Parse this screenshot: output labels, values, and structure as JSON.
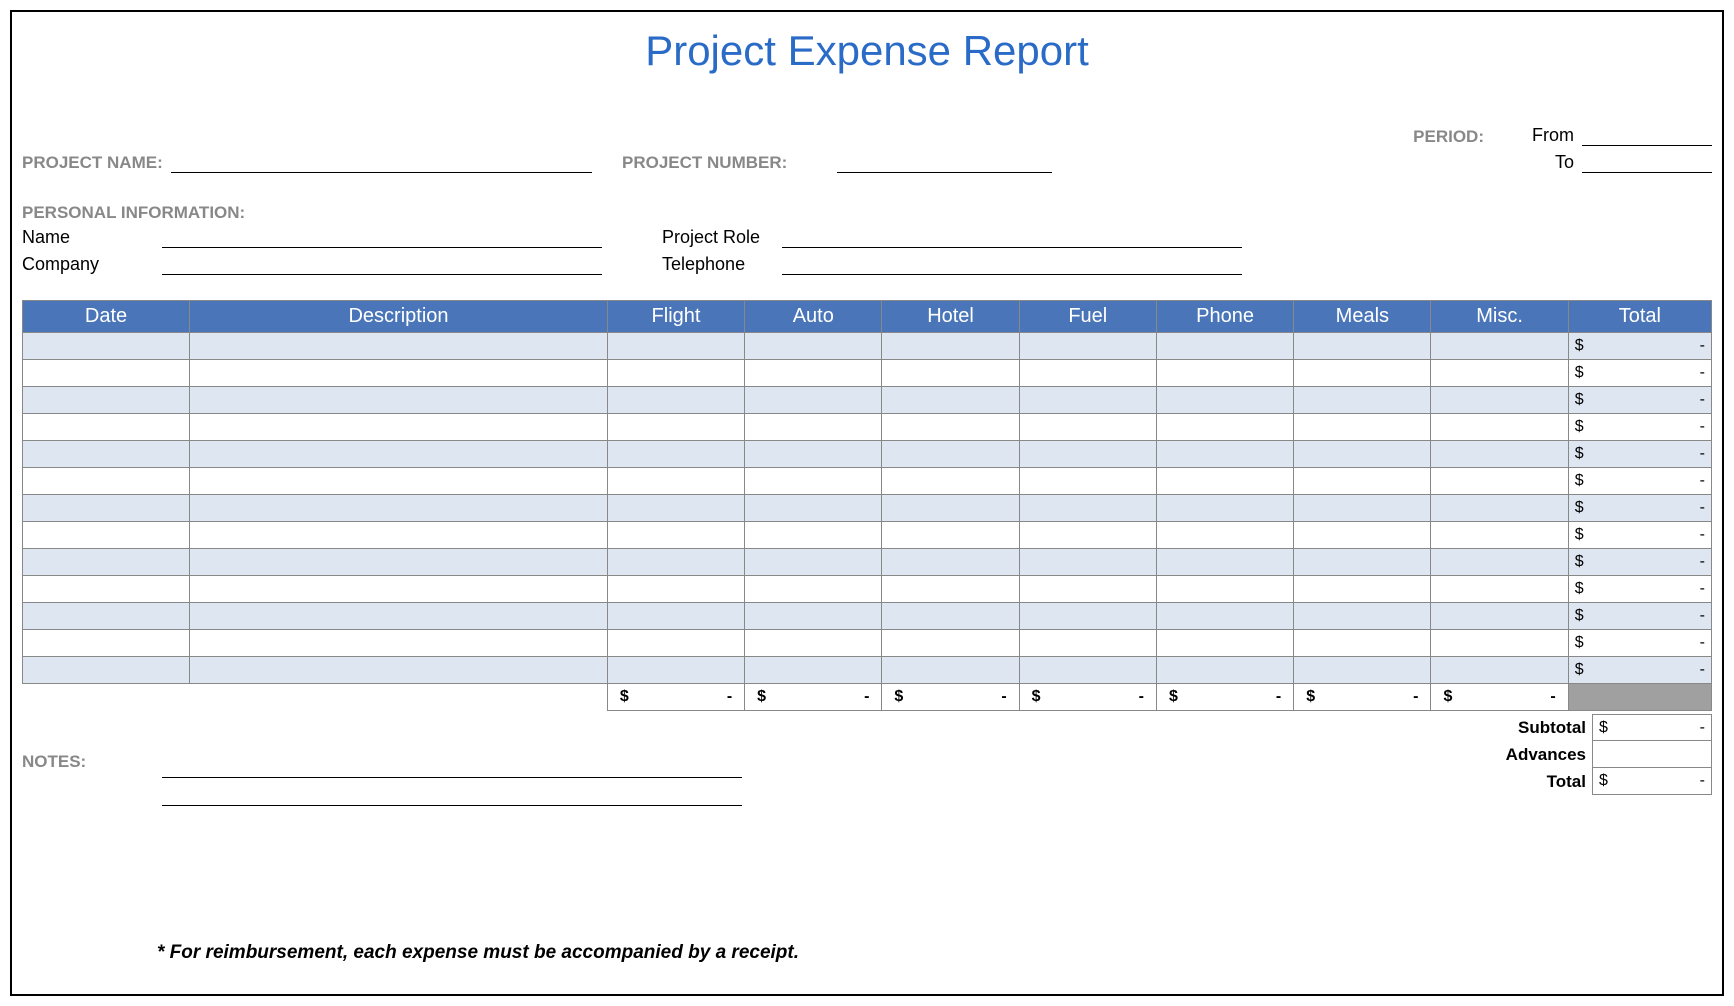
{
  "title": "Project Expense Report",
  "header": {
    "project_name_label": "PROJECT NAME:",
    "project_number_label": "PROJECT NUMBER:",
    "period_label": "PERIOD:",
    "from_label": "From",
    "to_label": "To"
  },
  "personal": {
    "section_label": "PERSONAL INFORMATION:",
    "name_label": "Name",
    "company_label": "Company",
    "role_label": "Project Role",
    "telephone_label": "Telephone"
  },
  "columns": {
    "date": "Date",
    "description": "Description",
    "flight": "Flight",
    "auto": "Auto",
    "hotel": "Hotel",
    "fuel": "Fuel",
    "phone": "Phone",
    "meals": "Meals",
    "misc": "Misc.",
    "total": "Total"
  },
  "currency": "$",
  "dash": "-",
  "summary": {
    "subtotal_label": "Subtotal",
    "advances_label": "Advances",
    "total_label": "Total",
    "subtotal": "-",
    "advances": "",
    "total": "-"
  },
  "notes_label": "NOTES:",
  "footnote": "* For reimbursement, each expense must be accompanied by a receipt."
}
